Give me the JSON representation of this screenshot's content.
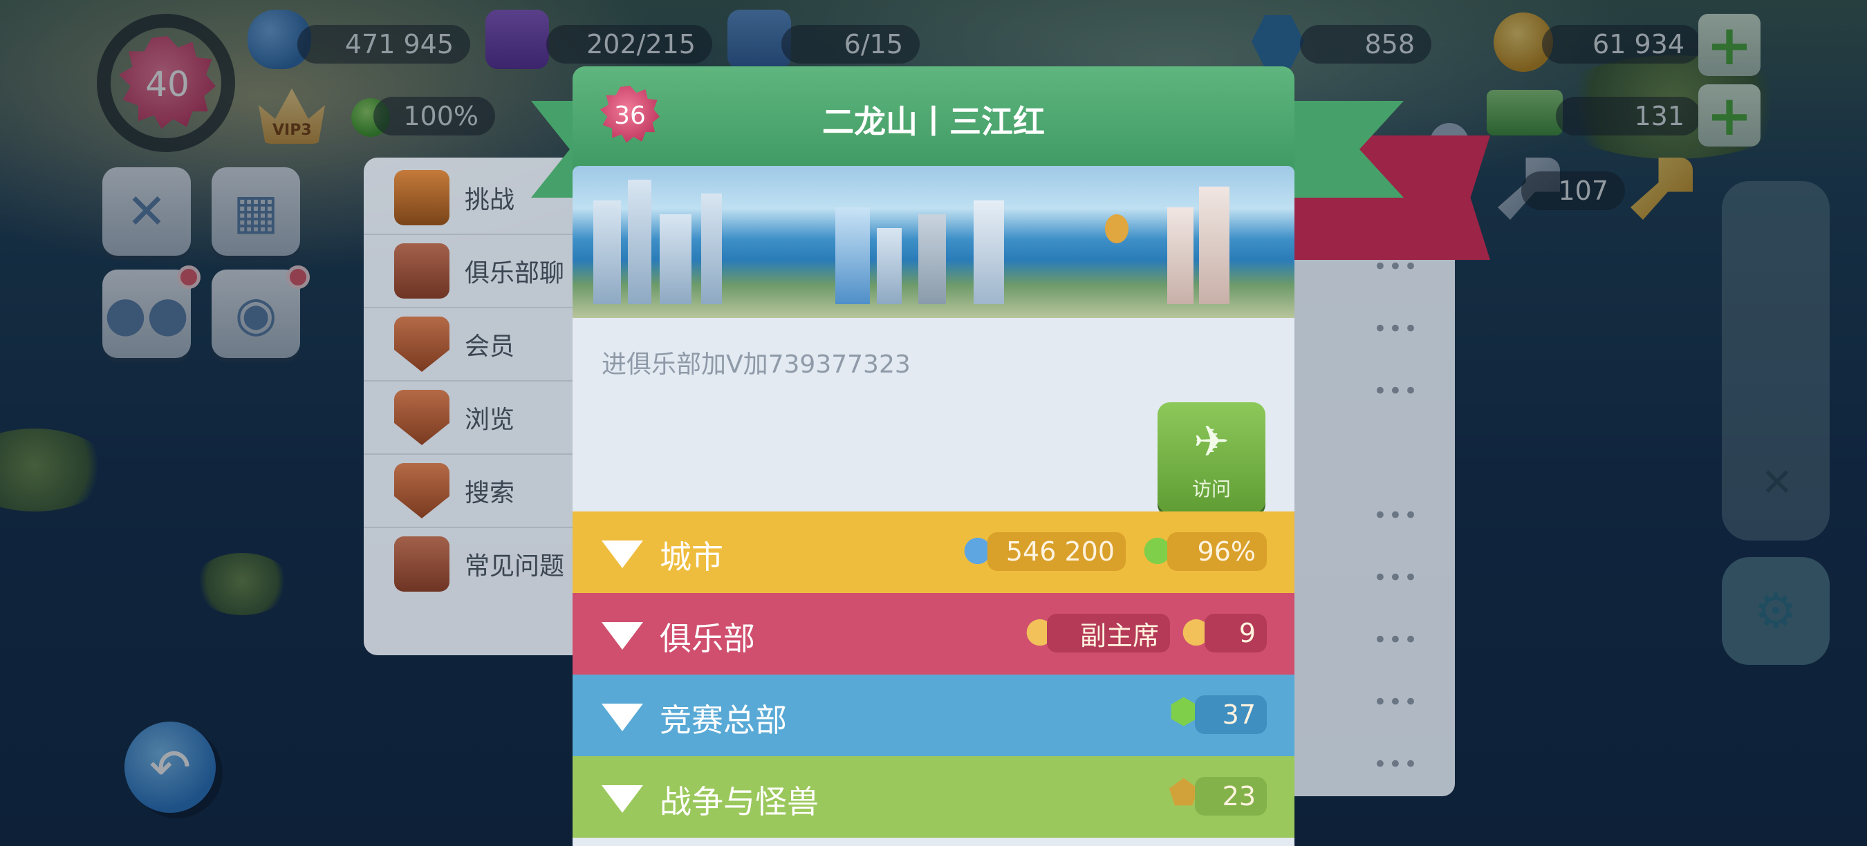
{
  "hud": {
    "level": "40",
    "population": "471 945",
    "storage": "202/215",
    "vehicles": "6/15",
    "neosimoleons": "858",
    "simoleons": "61 934",
    "happiness": "100%",
    "simcash": "131",
    "golden_keys": "107",
    "vip_label": "VIP3"
  },
  "side_menu": {
    "items": [
      {
        "label": "挑战",
        "icon": "treasure-chest-icon"
      },
      {
        "label": "俱乐部聊",
        "icon": "chat-bubble-icon"
      },
      {
        "label": "会员",
        "icon": "members-shield-icon"
      },
      {
        "label": "浏览",
        "icon": "browse-shield-icon"
      },
      {
        "label": "搜索",
        "icon": "magnifier-icon"
      },
      {
        "label": "常见问题",
        "icon": "faq-book-icon"
      }
    ]
  },
  "dialog": {
    "level": "36",
    "title": "二龙山丨三江红",
    "description": "进俱乐部加V加739377323",
    "visit_label": "访问",
    "rows": [
      {
        "label": "城市",
        "color": "#efbd3e",
        "stats": [
          "546 200",
          "96%"
        ]
      },
      {
        "label": "俱乐部",
        "color": "#d04f6e",
        "stats": [
          "副主席",
          "9"
        ]
      },
      {
        "label": "竞赛总部",
        "color": "#58a9d6",
        "stats": [
          "37"
        ]
      },
      {
        "label": "战争与怪兽",
        "color": "#9bc85c",
        "stats": [
          "23"
        ]
      }
    ]
  }
}
